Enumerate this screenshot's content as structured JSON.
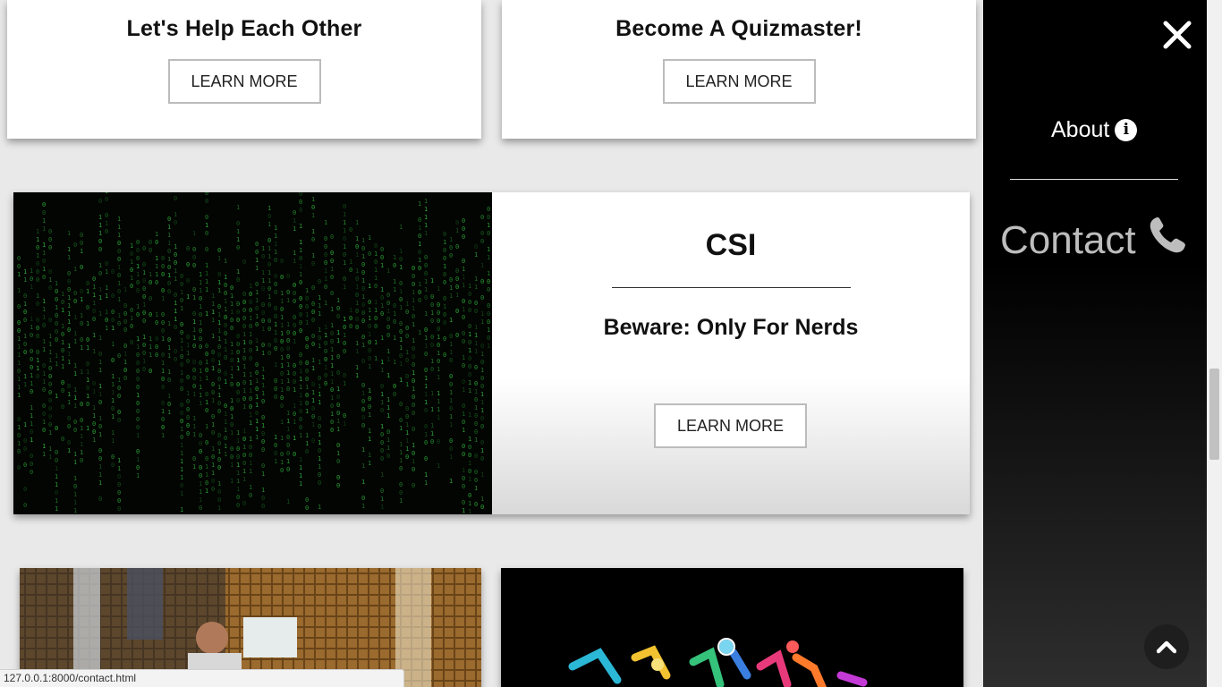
{
  "cards": [
    {
      "title": "Let's Help Each Other",
      "button": "LEARN MORE"
    },
    {
      "title": "Become A Quizmaster!",
      "button": "LEARN MORE"
    }
  ],
  "csi": {
    "title": "CSI",
    "subtitle": "Beware: Only For Nerds",
    "button": "LEARN MORE"
  },
  "sidebar": {
    "about": "About",
    "contact": "Contact"
  },
  "status_url": "127.0.0.1:8000/contact.html",
  "icons": {
    "close": "close-icon",
    "info": "info-icon",
    "phone": "phone-icon",
    "up": "chevron-up-icon"
  },
  "colors": {
    "sidebar_bg": "#000000",
    "matrix_green": "#2fa83a",
    "page_bg": "#e9e9e9"
  }
}
